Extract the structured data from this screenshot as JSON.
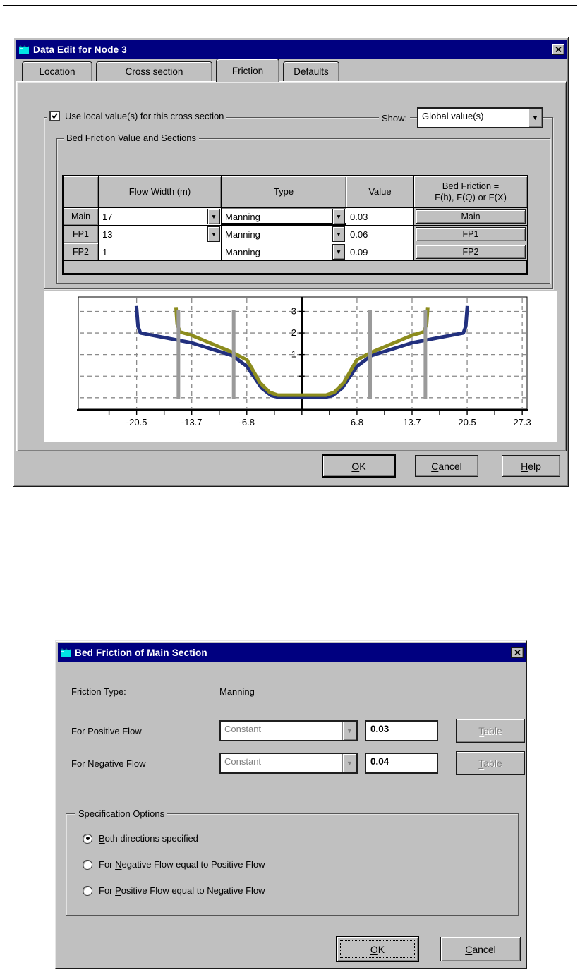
{
  "page": {
    "top_rule": true
  },
  "dialog1": {
    "title": "Data Edit for Node 3",
    "tabs": [
      {
        "label": "Location",
        "active": false
      },
      {
        "label": "Cross section",
        "active": false
      },
      {
        "label": "Friction",
        "active": true
      },
      {
        "label": "Defaults",
        "active": false
      }
    ],
    "use_local_label": {
      "t": "Use local value(s) for this cross section",
      "u": 0
    },
    "use_local_checked": true,
    "show_label": {
      "t": "Show:",
      "u": 2
    },
    "show_value": "Global value(s)",
    "group_caption": "Bed Friction Value and Sections",
    "table": {
      "headers": [
        "",
        "Flow Width (m)",
        "Type",
        "Value",
        "Bed Friction =\nF(h), F(Q) or F(X)"
      ],
      "rows": [
        {
          "row_header": "Main",
          "flow_width": "17",
          "flow_width_dropdown": true,
          "type": "Manning",
          "type_dropdown": true,
          "type_focused": true,
          "value": "0.03",
          "section_button": "Main"
        },
        {
          "row_header": "FP1",
          "flow_width": "13",
          "flow_width_dropdown": true,
          "type": "Manning",
          "type_dropdown": true,
          "type_focused": false,
          "value": "0.06",
          "section_button": "FP1"
        },
        {
          "row_header": "FP2",
          "flow_width": "1",
          "flow_width_dropdown": false,
          "type": "Manning",
          "type_dropdown": true,
          "type_focused": false,
          "value": "0.09",
          "section_button": "FP2"
        }
      ]
    },
    "buttons": {
      "ok": {
        "t": "OK",
        "u": 0
      },
      "cancel": {
        "t": "Cancel",
        "u": 0
      },
      "help": {
        "t": "Help",
        "u": 0
      }
    }
  },
  "chart_data": {
    "type": "line",
    "title": "",
    "xlabel": "",
    "ylabel": "",
    "xlim": [
      -27.7,
      27.9
    ],
    "ylim": [
      -1.53,
      3.67
    ],
    "grid": "dashed",
    "x_ticks": [
      {
        "x": -20.475,
        "label": "-20.5"
      },
      {
        "x": -13.65,
        "label": "-13.7"
      },
      {
        "x": -6.825,
        "label": "-6.8"
      },
      {
        "x": 6.825,
        "label": "6.8"
      },
      {
        "x": 13.65,
        "label": "13.7"
      },
      {
        "x": 20.475,
        "label": "20.5"
      },
      {
        "x": 27.3,
        "label": "27.3"
      }
    ],
    "x_minor_step": 3.4125,
    "y_gridlines": [
      -1,
      0,
      1,
      2,
      3
    ],
    "y_tick_labels": [
      1,
      2,
      3
    ],
    "series": [
      {
        "name": "local-cross-section",
        "color": "#22307E",
        "points": [
          [
            -20.5,
            3.25
          ],
          [
            -20.3,
            2.3
          ],
          [
            -20.0,
            2.0
          ],
          [
            -13.7,
            1.55
          ],
          [
            -8.6,
            0.95
          ],
          [
            -6.8,
            0.45
          ],
          [
            -5.0,
            -0.55
          ],
          [
            -3.8,
            -0.9
          ],
          [
            -3.0,
            -0.97
          ],
          [
            3.0,
            -0.97
          ],
          [
            3.8,
            -0.9
          ],
          [
            5.0,
            -0.55
          ],
          [
            6.8,
            0.45
          ],
          [
            8.6,
            0.95
          ],
          [
            13.7,
            1.55
          ],
          [
            20.0,
            2.0
          ],
          [
            20.3,
            2.3
          ],
          [
            20.5,
            3.25
          ]
        ]
      },
      {
        "name": "global-cross-section",
        "color": "#8C8C1E",
        "points": [
          [
            -15.6,
            3.2
          ],
          [
            -15.45,
            2.4
          ],
          [
            -15.1,
            2.05
          ],
          [
            -13.7,
            1.9
          ],
          [
            -8.6,
            1.1
          ],
          [
            -6.8,
            0.75
          ],
          [
            -5.2,
            -0.3
          ],
          [
            -4.0,
            -0.75
          ],
          [
            -3.0,
            -0.88
          ],
          [
            3.0,
            -0.88
          ],
          [
            4.0,
            -0.75
          ],
          [
            5.2,
            -0.3
          ],
          [
            6.8,
            0.75
          ],
          [
            8.6,
            1.1
          ],
          [
            13.7,
            1.9
          ],
          [
            15.1,
            2.05
          ],
          [
            15.45,
            2.4
          ],
          [
            15.6,
            3.2
          ]
        ]
      }
    ],
    "divider_bars": {
      "color": "#9A9A9A",
      "x": [
        -15.3,
        -8.45,
        8.45,
        15.3
      ],
      "y0": -1.05,
      "y1": 3.08
    }
  },
  "dialog2": {
    "title": "Bed Friction of Main Section",
    "friction_type_label": "Friction Type:",
    "friction_type_value": "Manning",
    "positive_row": {
      "label": "For Positive Flow",
      "method": "Constant",
      "value": "0.03",
      "table_button": {
        "t": "Table",
        "u": 0
      }
    },
    "negative_row": {
      "label": "For Negative Flow",
      "method": "Constant",
      "value": "0.04",
      "table_button": {
        "t": "Table",
        "u": 0
      }
    },
    "spec_group": {
      "caption": "Specification Options",
      "options": [
        {
          "t": "Both directions specified",
          "u": 0,
          "selected": true
        },
        {
          "t": "For Negative Flow equal to Positive Flow",
          "u": 4,
          "selected": false
        },
        {
          "t": "For Positive Flow equal to Negative Flow",
          "u": 4,
          "selected": false
        }
      ]
    },
    "buttons": {
      "ok": {
        "t": "OK",
        "u": 0
      },
      "cancel": {
        "t": "Cancel",
        "u": 0
      }
    }
  },
  "colors": {
    "titlebar": "#000080",
    "dialog": "#C0C0C0",
    "local_series": "#22307E",
    "global_series": "#8C8C1E",
    "divider_bars": "#9A9A9A"
  }
}
